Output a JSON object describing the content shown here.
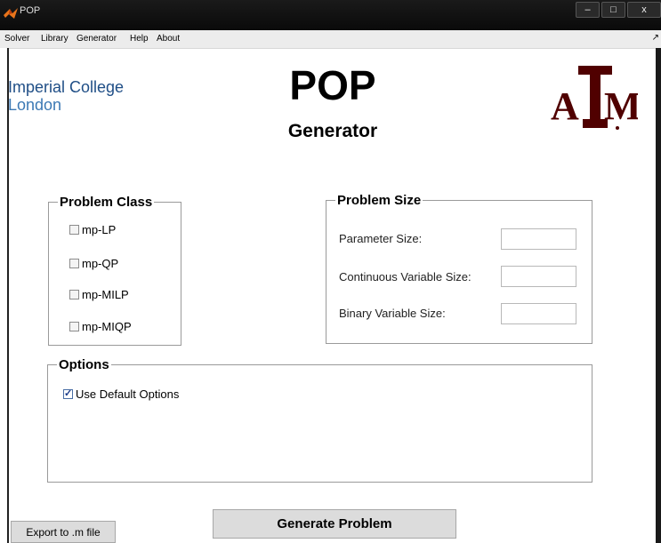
{
  "window": {
    "title": "POP",
    "controls": {
      "minimize": "‒",
      "maximize": "□",
      "close": "x"
    }
  },
  "menu": {
    "items": [
      "Solver",
      "Library",
      "Generator",
      "Help",
      "About"
    ],
    "overflow": "↗"
  },
  "logos": {
    "imperial_line1": "Imperial College",
    "imperial_line2": "London",
    "tamu_letters": "ATM"
  },
  "heading": {
    "title": "POP",
    "subtitle": "Generator"
  },
  "problem_class": {
    "legend": "Problem Class",
    "options": [
      {
        "label": "mp-LP",
        "checked": false
      },
      {
        "label": "mp-QP",
        "checked": false
      },
      {
        "label": "mp-MILP",
        "checked": false
      },
      {
        "label": "mp-MIQP",
        "checked": false
      }
    ]
  },
  "problem_size": {
    "legend": "Problem Size",
    "fields": [
      {
        "label": "Parameter Size:",
        "value": ""
      },
      {
        "label": "Continuous Variable Size:",
        "value": ""
      },
      {
        "label": "Binary Variable Size:",
        "value": ""
      }
    ]
  },
  "options": {
    "legend": "Options",
    "use_default": {
      "label": "Use Default Options",
      "checked": true
    }
  },
  "buttons": {
    "export": "Export to .m file",
    "generate": "Generate Problem"
  },
  "colors": {
    "imperial_blue": "#1f4e86",
    "tamu_maroon": "#500000"
  }
}
